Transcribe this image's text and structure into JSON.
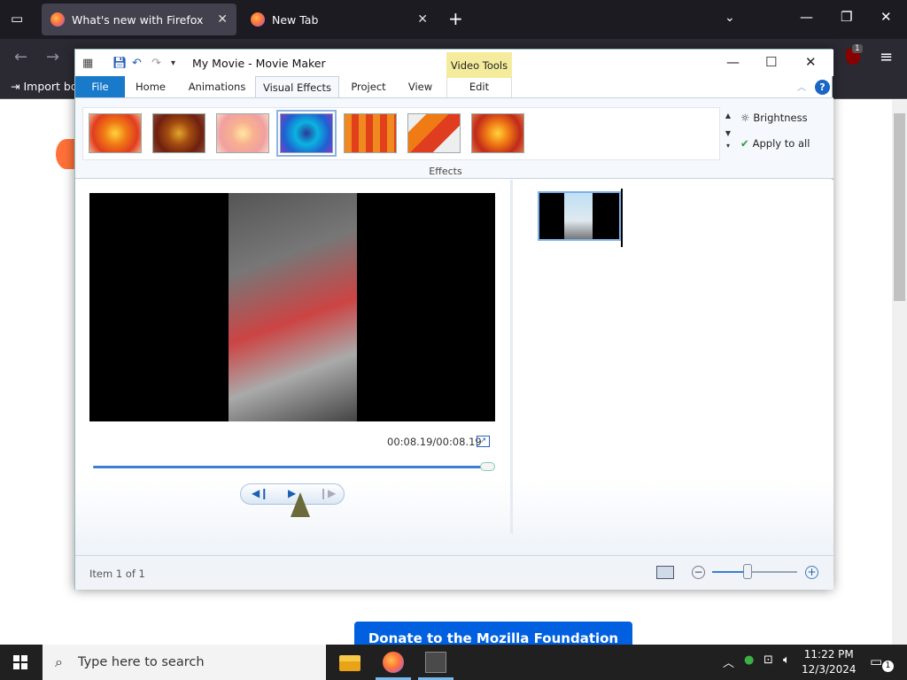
{
  "firefox": {
    "tabs": [
      {
        "label": "What's new with Firefox",
        "active": true
      },
      {
        "label": "New Tab",
        "active": false
      }
    ],
    "bookmarks_label": "Import bo",
    "ublock_badge": "1",
    "donate_label": "Donate to the Mozilla Foundation"
  },
  "moviemaker": {
    "title": "My Movie - Movie Maker",
    "context_tab": "Video Tools",
    "tabs": [
      "File",
      "Home",
      "Animations",
      "Visual Effects",
      "Project",
      "View",
      "Edit"
    ],
    "active_tab": "Visual Effects",
    "ribbon": {
      "group_label": "Effects",
      "effects_count": 7,
      "selected_effect_index": 3,
      "brightness_label": "Brightness",
      "apply_all_label": "Apply to all"
    },
    "preview": {
      "time": "00:08.19/00:08.19",
      "progress": 1.0
    },
    "status": {
      "item_text": "Item 1 of 1",
      "zoom_level": 0.42
    }
  },
  "taskbar": {
    "search_placeholder": "Type here to search",
    "time": "11:22 PM",
    "date": "12/3/2024",
    "notification_count": "1"
  },
  "colors": {
    "firefox_tabbar": "#1c1b22",
    "file_tab": "#1979ca",
    "video_tools": "#f4ec9c",
    "donate": "#0060df",
    "taskbar": "#202020"
  }
}
